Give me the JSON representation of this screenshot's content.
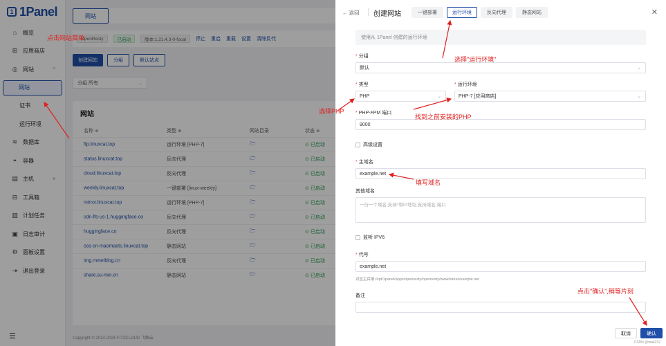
{
  "sidebar": {
    "logo": "1Panel",
    "logo_mark": "1",
    "items": [
      {
        "label": "概览",
        "icon": "home-icon",
        "glyph": "⌂"
      },
      {
        "label": "应用商店",
        "icon": "grid-icon",
        "glyph": "⊞"
      },
      {
        "label": "网站",
        "icon": "globe-icon",
        "glyph": "◎"
      },
      {
        "label": "网站",
        "icon": "",
        "glyph": "▌"
      },
      {
        "label": "证书",
        "icon": "",
        "glyph": ""
      },
      {
        "label": "运行环境",
        "icon": "",
        "glyph": ""
      },
      {
        "label": "数据库",
        "icon": "database-icon",
        "glyph": "≋"
      },
      {
        "label": "容器",
        "icon": "whale-icon",
        "glyph": "◓"
      },
      {
        "label": "主机",
        "icon": "server-icon",
        "glyph": "▤"
      },
      {
        "label": "工具箱",
        "icon": "toolbox-icon",
        "glyph": "⊟"
      },
      {
        "label": "计划任务",
        "icon": "list-icon",
        "glyph": "▥"
      },
      {
        "label": "日志审计",
        "icon": "log-icon",
        "glyph": "▣"
      },
      {
        "label": "面板设置",
        "icon": "gear-icon",
        "glyph": "⚙"
      },
      {
        "label": "退出登录",
        "icon": "logout-icon",
        "glyph": "⇥"
      }
    ],
    "menu_icon": "☰"
  },
  "main": {
    "tab_label": "网站",
    "status": {
      "app_name": "OpenResty",
      "state": "已启动",
      "version": "版本:1.21.4.3-0-focal",
      "actions": [
        "停止",
        "重启",
        "重载",
        "设置",
        "清除反代"
      ]
    },
    "toolbar": {
      "create": "创建网站",
      "group": "分组",
      "default": "默认站点"
    },
    "filter": {
      "label": "分组",
      "value": "所有"
    },
    "table": {
      "title": "网站",
      "headers": [
        "名称 ≑",
        "类型 ≑",
        "网站目录",
        "状态 ≑"
      ],
      "rows": [
        {
          "name": "ftp.linuxcat.top",
          "type": "运行环境 [PHP-7]",
          "status": "已启动"
        },
        {
          "name": "status.linuxcat.top",
          "type": "反向代理",
          "status": "已启动"
        },
        {
          "name": "cloud.linuxcat.top",
          "type": "反向代理",
          "status": "已启动"
        },
        {
          "name": "weekly.linuxcat.top",
          "type": "一键部署 [linux-weekly]",
          "status": "已启动"
        },
        {
          "name": "mirror.linuxcat.top",
          "type": "运行环境 [PHP-7]",
          "status": "已启动"
        },
        {
          "name": "cdn-lfs-us-1.huggingface.co",
          "type": "反向代理",
          "status": "已启动"
        },
        {
          "name": "huggingface.co",
          "type": "反向代理",
          "status": "已启动"
        },
        {
          "name": "oss-cn-maomaotc.linuxcat.top",
          "type": "静态网站",
          "status": "已启动"
        },
        {
          "name": "img.mmeiblog.cn",
          "type": "反向代理",
          "status": "已启动"
        },
        {
          "name": "share.su-mei.cn",
          "type": "静态网站",
          "status": "已启动"
        }
      ]
    },
    "footer": "Copyright © 2014-2024 FIT2CLOUD 飞致云"
  },
  "drawer": {
    "back": "返回",
    "title": "创建网站",
    "tabs": [
      "一键部署",
      "运行环境",
      "反向代理",
      "静态网站"
    ],
    "hint": "使用从 1Panel 创建的运行环境",
    "group": {
      "label": "分组",
      "value": "默认"
    },
    "type": {
      "label": "类型",
      "value": "PHP"
    },
    "runtime": {
      "label": "运行环境",
      "value": "PHP-7 [应用商店]"
    },
    "fpm": {
      "label": "PHP-FPM 端口",
      "value": "9000"
    },
    "advanced": "高级设置",
    "domain": {
      "label": "主域名",
      "value": "example.net"
    },
    "other_domains": {
      "label": "其他域名",
      "placeholder": "一行一个域名,支持*和IP地址,支持域名:端口"
    },
    "ipv6": "监听 IPV6",
    "alias": {
      "label": "代号",
      "value": "example.net"
    },
    "alias_note": "对应主目录:/opt/1panel/apps/openresty/openresty/www/sites/example.net",
    "remark": {
      "label": "备注"
    },
    "cancel": "取消",
    "confirm": "确认",
    "watermark": "CSDN @mak232"
  },
  "annotations": {
    "a1": "点击网站菜单",
    "a2": "选择\"运行环境\"",
    "a3": "选择PHP",
    "a4": "找到之前安装的PHP",
    "a5": "填写域名",
    "a6": "点击\"确认\",稍等片刻"
  },
  "colors": {
    "primary": "#1f4fa8",
    "annotation": "#e02020",
    "success": "#2c9b50"
  }
}
